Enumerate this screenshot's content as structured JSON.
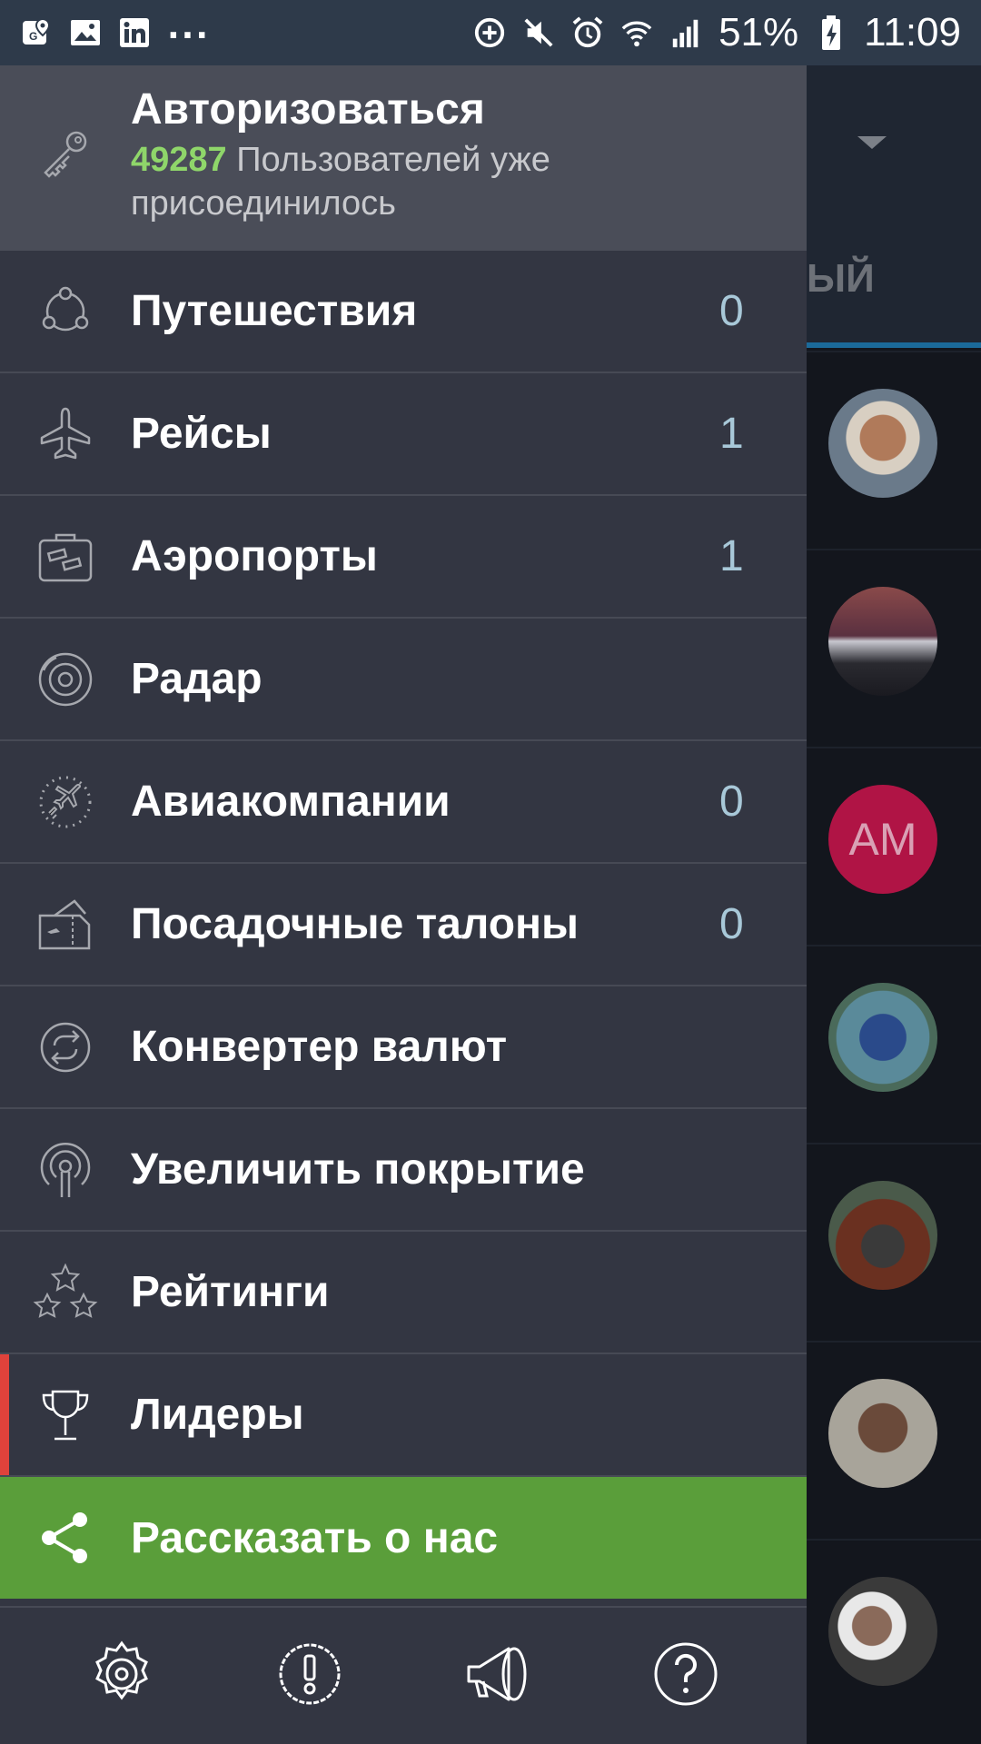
{
  "status_bar": {
    "left_icons": [
      "maps-icon",
      "image-icon",
      "linkedin-icon"
    ],
    "more": "...",
    "battery": "51%",
    "time": "11:09"
  },
  "background": {
    "tab_text": "ЫЙ",
    "avatar_initials": "AM"
  },
  "drawer": {
    "login": {
      "title": "Авторизоваться",
      "count": "49287",
      "subtitle": "Пользователей уже присоединилось"
    },
    "items": [
      {
        "label": "Путешествия",
        "count": "0",
        "icon": "trips-icon"
      },
      {
        "label": "Рейсы",
        "count": "1",
        "icon": "plane-icon"
      },
      {
        "label": "Аэропорты",
        "count": "1",
        "icon": "luggage-icon"
      },
      {
        "label": "Радар",
        "count": "",
        "icon": "radar-icon"
      },
      {
        "label": "Авиакомпании",
        "count": "0",
        "icon": "airlines-icon"
      },
      {
        "label": "Посадочные талоны",
        "count": "0",
        "icon": "boarding-pass-icon"
      },
      {
        "label": "Конвертер валют",
        "count": "",
        "icon": "currency-converter-icon"
      },
      {
        "label": "Увеличить покрытие",
        "count": "",
        "icon": "antenna-icon"
      },
      {
        "label": "Рейтинги",
        "count": "",
        "icon": "stars-icon"
      },
      {
        "label": "Лидеры",
        "count": "",
        "icon": "trophy-icon"
      }
    ],
    "share_label": "Рассказать о нас",
    "bottom_buttons": [
      "settings-icon",
      "alert-icon",
      "megaphone-icon",
      "help-icon"
    ]
  },
  "colors": {
    "status_bar": "#2e3a4a",
    "drawer": "#333642",
    "login_bg": "#4a4d58",
    "accent_green": "#8fd66a",
    "share_bg": "#5a9e3a",
    "active_marker": "#e0423b",
    "count_color": "#a8c8d8"
  }
}
